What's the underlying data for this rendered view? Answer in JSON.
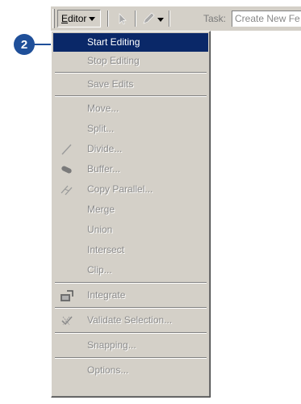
{
  "toolbar": {
    "editor_prefix": "E",
    "editor_rest": "ditor",
    "task_label": "Task:",
    "task_value": "Create New Fe"
  },
  "callout": {
    "number": "2"
  },
  "menu": {
    "items": [
      {
        "label": "Start Editing",
        "enabled": true,
        "highlighted": true,
        "icon": ""
      },
      {
        "label": "Stop Editing",
        "enabled": false,
        "icon": ""
      },
      {
        "label": "Save Edits",
        "enabled": false,
        "icon": ""
      },
      {
        "label": "Move...",
        "enabled": false,
        "icon": ""
      },
      {
        "label": "Split...",
        "enabled": false,
        "icon": ""
      },
      {
        "label": "Divide...",
        "enabled": false,
        "icon": "divide-icon"
      },
      {
        "label": "Buffer...",
        "enabled": false,
        "icon": "buffer-icon"
      },
      {
        "label": "Copy Parallel...",
        "enabled": false,
        "icon": "copy-parallel-icon"
      },
      {
        "label": "Merge",
        "enabled": false,
        "icon": ""
      },
      {
        "label": "Union",
        "enabled": false,
        "icon": ""
      },
      {
        "label": "Intersect",
        "enabled": false,
        "icon": ""
      },
      {
        "label": "Clip...",
        "enabled": false,
        "icon": ""
      },
      {
        "label": "Integrate",
        "enabled": false,
        "icon": "integrate-icon"
      },
      {
        "label": "Validate Selection...",
        "enabled": false,
        "icon": "validate-selection-icon"
      },
      {
        "label": "Snapping...",
        "enabled": false,
        "icon": ""
      },
      {
        "label": "Options...",
        "enabled": false,
        "icon": ""
      }
    ]
  },
  "colors": {
    "highlight": "#0a2868",
    "callout": "#1f4f99",
    "chrome": "#d4d0c8"
  }
}
